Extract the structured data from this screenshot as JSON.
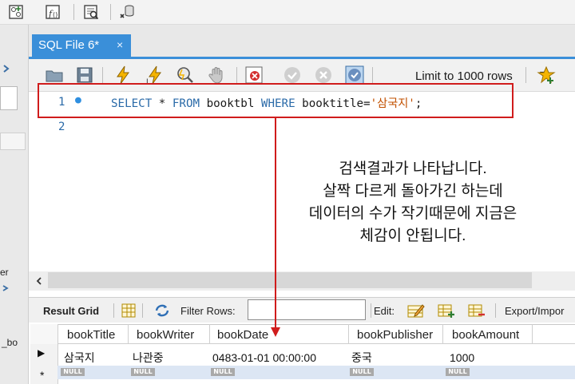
{
  "editor": {
    "tab_label": "SQL File 6*",
    "tab_close": "×",
    "limit_label": "Limit to 1000 rows",
    "limit_arrow": "▾",
    "line_numbers": [
      "1",
      "2"
    ],
    "current_line_marker": "●",
    "code": {
      "kw_select": "SELECT",
      "star": " * ",
      "kw_from": "FROM",
      "table": " booktbl ",
      "kw_where": "WHERE",
      "condition": " booktitle=",
      "value": "'삼국지'",
      "semicolon": ";"
    }
  },
  "annotation": {
    "lines": [
      "검색결과가 나타납니다.",
      "살짝 다르게 돌아가긴 하는데",
      "데이터의 수가 작기때문에 지금은",
      "체감이 안됩니다."
    ]
  },
  "sidebar": {
    "partial_text_1": "er",
    "partial_text_2": "_bo"
  },
  "result_toolbar": {
    "result_grid_label": "Result Grid",
    "filter_rows_label": "Filter Rows:",
    "edit_label": "Edit:",
    "export_label": "Export/Impor"
  },
  "grid": {
    "columns": [
      "bookTitle",
      "bookWriter",
      "bookDate",
      "bookPublisher",
      "bookAmount"
    ],
    "rows": [
      [
        "삼국지",
        "나관중",
        "0483-01-01 00:00:00",
        "중국",
        "1000"
      ]
    ],
    "null_label": "NULL",
    "current_row_marker": "▶",
    "new_row_marker": "*"
  },
  "colors": {
    "tab_active": "#3a8fd9",
    "highlight_border": "#d01c1c",
    "keyword": "#2a6aa8",
    "string": "#c25000"
  }
}
